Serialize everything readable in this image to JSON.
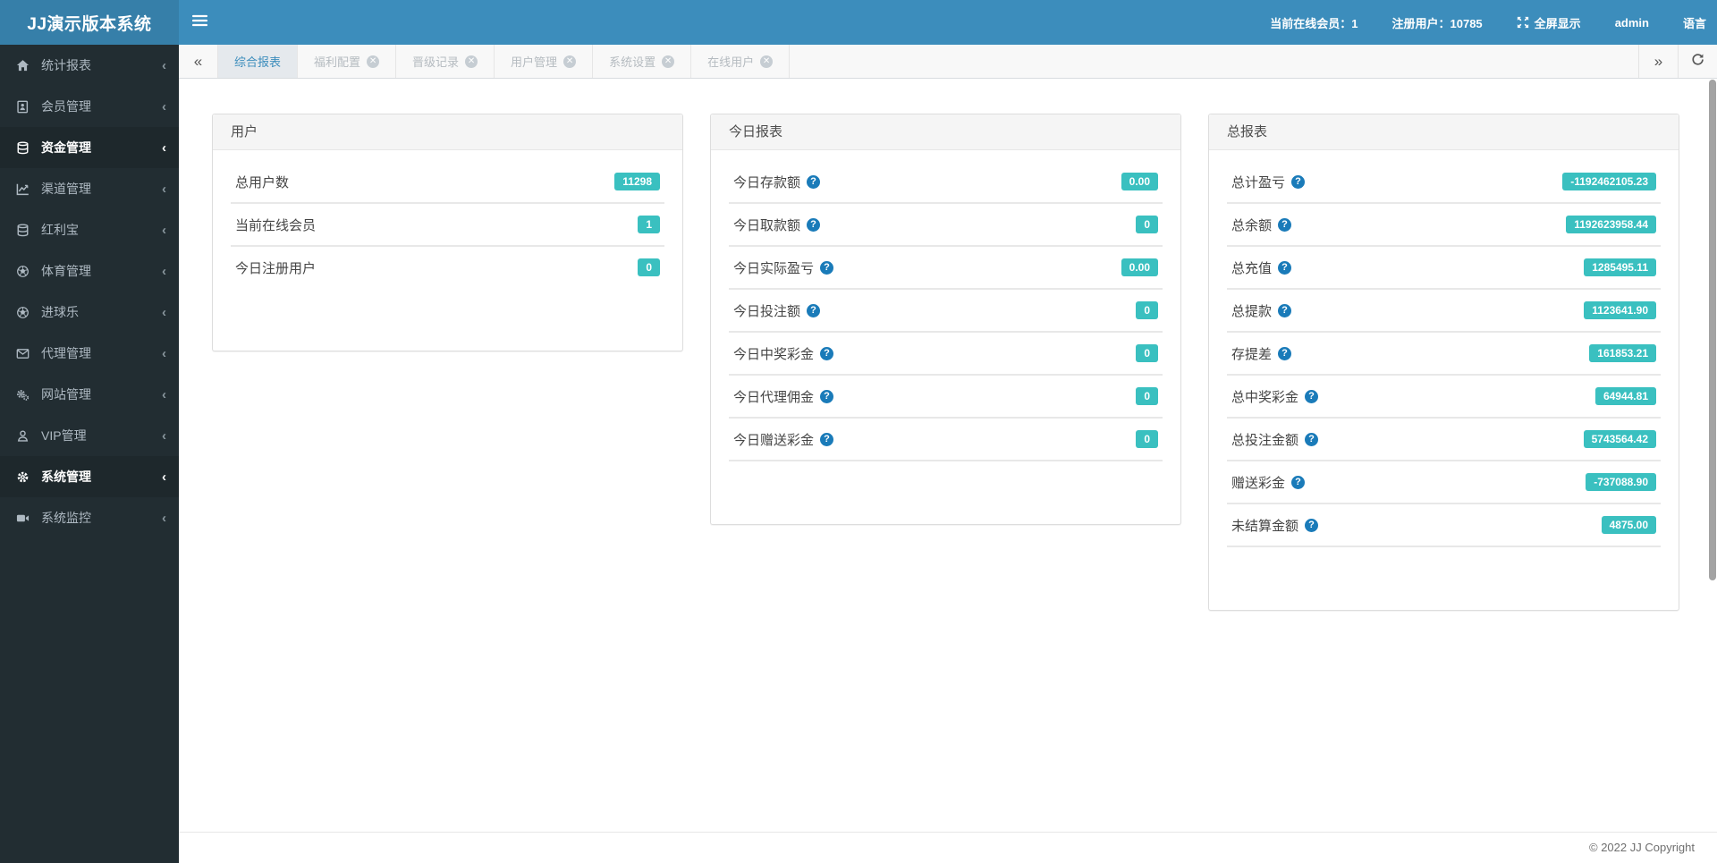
{
  "header": {
    "logo": "JJ演示版本系统",
    "online_members": "当前在线会员：1",
    "registered_users": "注册用户：10785",
    "fullscreen_label": "全屏显示",
    "username": "admin",
    "language_label": "语言"
  },
  "sidebar": {
    "items": [
      {
        "key": "stats-report",
        "icon": "home",
        "label": "统计报表",
        "active": false
      },
      {
        "key": "member-management",
        "icon": "address-book",
        "label": "会员管理",
        "active": false
      },
      {
        "key": "funds-management",
        "icon": "database",
        "label": "资金管理",
        "active": true
      },
      {
        "key": "channel-management",
        "icon": "line-chart",
        "label": "渠道管理",
        "active": false
      },
      {
        "key": "bonus-treasure",
        "icon": "database",
        "label": "红利宝",
        "active": false
      },
      {
        "key": "sports-management",
        "icon": "futbol",
        "label": "体育管理",
        "active": false
      },
      {
        "key": "goal-fun",
        "icon": "futbol",
        "label": "进球乐",
        "active": false
      },
      {
        "key": "agent-management",
        "icon": "envelope",
        "label": "代理管理",
        "active": false
      },
      {
        "key": "site-management",
        "icon": "cogs",
        "label": "网站管理",
        "active": false
      },
      {
        "key": "vip-management",
        "icon": "user",
        "label": "VIP管理",
        "active": false
      },
      {
        "key": "system-management",
        "icon": "gear",
        "label": "系统管理",
        "active": true
      },
      {
        "key": "system-monitor",
        "icon": "video-camera",
        "label": "系统监控",
        "active": false
      }
    ]
  },
  "tabs": {
    "items": [
      {
        "key": "comprehensive-report",
        "label": "综合报表",
        "active": true,
        "closable": false
      },
      {
        "key": "welfare-config",
        "label": "福利配置",
        "active": false,
        "closable": true
      },
      {
        "key": "promotion-record",
        "label": "晋级记录",
        "active": false,
        "closable": true
      },
      {
        "key": "user-management",
        "label": "用户管理",
        "active": false,
        "closable": true
      },
      {
        "key": "system-settings",
        "label": "系统设置",
        "active": false,
        "closable": true
      },
      {
        "key": "online-users",
        "label": "在线用户",
        "active": false,
        "closable": true
      }
    ]
  },
  "panels": [
    {
      "key": "users",
      "title": "用户",
      "trailing_separator": false,
      "rows": [
        {
          "label": "总用户数",
          "value": "11298",
          "help": false
        },
        {
          "label": "当前在线会员",
          "value": "1",
          "help": false
        },
        {
          "label": "今日注册用户",
          "value": "0",
          "help": false
        }
      ]
    },
    {
      "key": "today-report",
      "title": "今日报表",
      "trailing_separator": true,
      "rows": [
        {
          "label": "今日存款额",
          "value": "0.00",
          "help": true
        },
        {
          "label": "今日取款额",
          "value": "0",
          "help": true
        },
        {
          "label": "今日实际盈亏",
          "value": "0.00",
          "help": true
        },
        {
          "label": "今日投注额",
          "value": "0",
          "help": true
        },
        {
          "label": "今日中奖彩金",
          "value": "0",
          "help": true
        },
        {
          "label": "今日代理佣金",
          "value": "0",
          "help": true
        },
        {
          "label": "今日赠送彩金",
          "value": "0",
          "help": true
        }
      ]
    },
    {
      "key": "total-report",
      "title": "总报表",
      "trailing_separator": true,
      "rows": [
        {
          "label": "总计盈亏",
          "value": "-1192462105.23",
          "help": true
        },
        {
          "label": "总余额",
          "value": "1192623958.44",
          "help": true
        },
        {
          "label": "总充值",
          "value": "1285495.11",
          "help": true
        },
        {
          "label": "总提款",
          "value": "1123641.90",
          "help": true
        },
        {
          "label": "存提差",
          "value": "161853.21",
          "help": true
        },
        {
          "label": "总中奖彩金",
          "value": "64944.81",
          "help": true
        },
        {
          "label": "总投注金额",
          "value": "5743564.42",
          "help": true
        },
        {
          "label": "赠送彩金",
          "value": "-737088.90",
          "help": true
        },
        {
          "label": "未结算金额",
          "value": "4875.00",
          "help": true
        }
      ]
    }
  ],
  "footer": {
    "copyright": "© 2022 JJ Copyright"
  },
  "colors": {
    "topbar": "#3c8dbc",
    "logo_bg": "#367fa9",
    "sidebar_bg": "#222d32",
    "sidebar_active_bg": "#1e282c",
    "tab_active_text": "#3c8dbc",
    "badge": "#3ac0c0",
    "help_icon": "#1a7bb9"
  }
}
